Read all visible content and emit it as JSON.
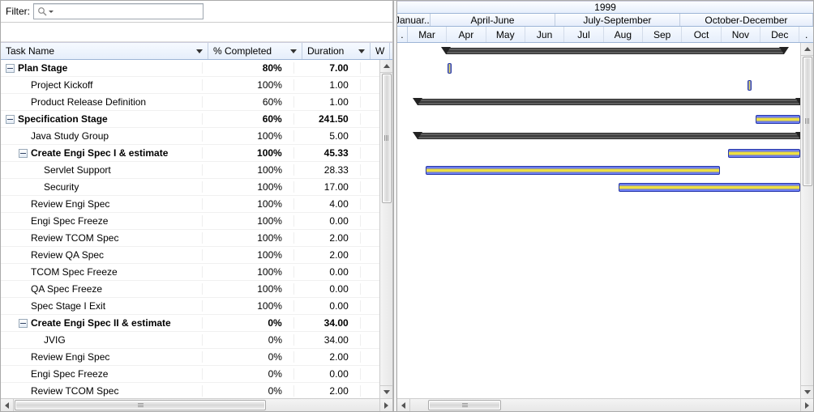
{
  "filter": {
    "label": "Filter:",
    "placeholder": ""
  },
  "columns": {
    "task": "Task Name",
    "pct": "% Completed",
    "dur": "Duration",
    "w": "W"
  },
  "rows": [
    {
      "level": 0,
      "bold": true,
      "expand": true,
      "name": "Plan Stage",
      "pct": "80%",
      "dur": "7.00"
    },
    {
      "level": 1,
      "bold": false,
      "expand": false,
      "name": "Project Kickoff",
      "pct": "100%",
      "dur": "1.00"
    },
    {
      "level": 1,
      "bold": false,
      "expand": false,
      "name": "Product Release Definition",
      "pct": "60%",
      "dur": "1.00"
    },
    {
      "level": 0,
      "bold": true,
      "expand": true,
      "name": "Specification Stage",
      "pct": "60%",
      "dur": "241.50"
    },
    {
      "level": 1,
      "bold": false,
      "expand": false,
      "name": "Java Study Group",
      "pct": "100%",
      "dur": "5.00"
    },
    {
      "level": 1,
      "bold": true,
      "expand": true,
      "name": "Create Engi Spec I & estimate",
      "pct": "100%",
      "dur": "45.33"
    },
    {
      "level": 2,
      "bold": false,
      "expand": false,
      "name": "Servlet Support",
      "pct": "100%",
      "dur": "28.33"
    },
    {
      "level": 2,
      "bold": false,
      "expand": false,
      "name": "Security",
      "pct": "100%",
      "dur": "17.00"
    },
    {
      "level": 1,
      "bold": false,
      "expand": false,
      "name": "Review Engi Spec",
      "pct": "100%",
      "dur": "4.00"
    },
    {
      "level": 1,
      "bold": false,
      "expand": false,
      "name": "Engi Spec Freeze",
      "pct": "100%",
      "dur": "0.00"
    },
    {
      "level": 1,
      "bold": false,
      "expand": false,
      "name": "Review TCOM Spec",
      "pct": "100%",
      "dur": "2.00"
    },
    {
      "level": 1,
      "bold": false,
      "expand": false,
      "name": "Review QA Spec",
      "pct": "100%",
      "dur": "2.00"
    },
    {
      "level": 1,
      "bold": false,
      "expand": false,
      "name": "TCOM Spec Freeze",
      "pct": "100%",
      "dur": "0.00"
    },
    {
      "level": 1,
      "bold": false,
      "expand": false,
      "name": "QA Spec Freeze",
      "pct": "100%",
      "dur": "0.00"
    },
    {
      "level": 1,
      "bold": false,
      "expand": false,
      "name": "Spec Stage I Exit",
      "pct": "100%",
      "dur": "0.00"
    },
    {
      "level": 1,
      "bold": true,
      "expand": true,
      "name": "Create Engi Spec II & estimate",
      "pct": "0%",
      "dur": "34.00"
    },
    {
      "level": 2,
      "bold": false,
      "expand": false,
      "name": "JVIG",
      "pct": "0%",
      "dur": "34.00"
    },
    {
      "level": 1,
      "bold": false,
      "expand": false,
      "name": "Review Engi Spec",
      "pct": "0%",
      "dur": "2.00"
    },
    {
      "level": 1,
      "bold": false,
      "expand": false,
      "name": "Engi Spec Freeze",
      "pct": "0%",
      "dur": "0.00"
    },
    {
      "level": 1,
      "bold": false,
      "expand": false,
      "name": "Review TCOM Spec",
      "pct": "0%",
      "dur": "2.00"
    }
  ],
  "timeline": {
    "year": "1999",
    "quarters": [
      {
        "label": "Januar...",
        "width": "8%"
      },
      {
        "label": "April-June",
        "width": "30%"
      },
      {
        "label": "July-September",
        "width": "30%"
      },
      {
        "label": "October-December",
        "width": "32%"
      }
    ],
    "months": [
      ".",
      "Mar",
      "Apr",
      "May",
      "Jun",
      "Jul",
      "Aug",
      "Sep",
      "Oct",
      "Nov",
      "Dec",
      "."
    ],
    "leftMargin": 20,
    "rightMargin": 16
  },
  "bars": [
    {
      "row": 0,
      "type": "summary",
      "left": "12%",
      "right": "4%"
    },
    {
      "row": 1,
      "type": "tiny",
      "left": "12.5%"
    },
    {
      "row": 2,
      "type": "tiny",
      "left": "87%"
    },
    {
      "row": 3,
      "type": "summary",
      "left": "5%",
      "right": "0%"
    },
    {
      "row": 4,
      "type": "task",
      "left": "89%",
      "right": "0%"
    },
    {
      "row": 5,
      "type": "summary",
      "left": "5%",
      "right": "0%"
    },
    {
      "row": 6,
      "type": "task",
      "left": "82%",
      "right": "0%"
    },
    {
      "row": 7,
      "type": "task",
      "left": "7%",
      "right": "20%"
    },
    {
      "row": 8,
      "type": "task",
      "left": "55%",
      "right": "0%"
    }
  ]
}
